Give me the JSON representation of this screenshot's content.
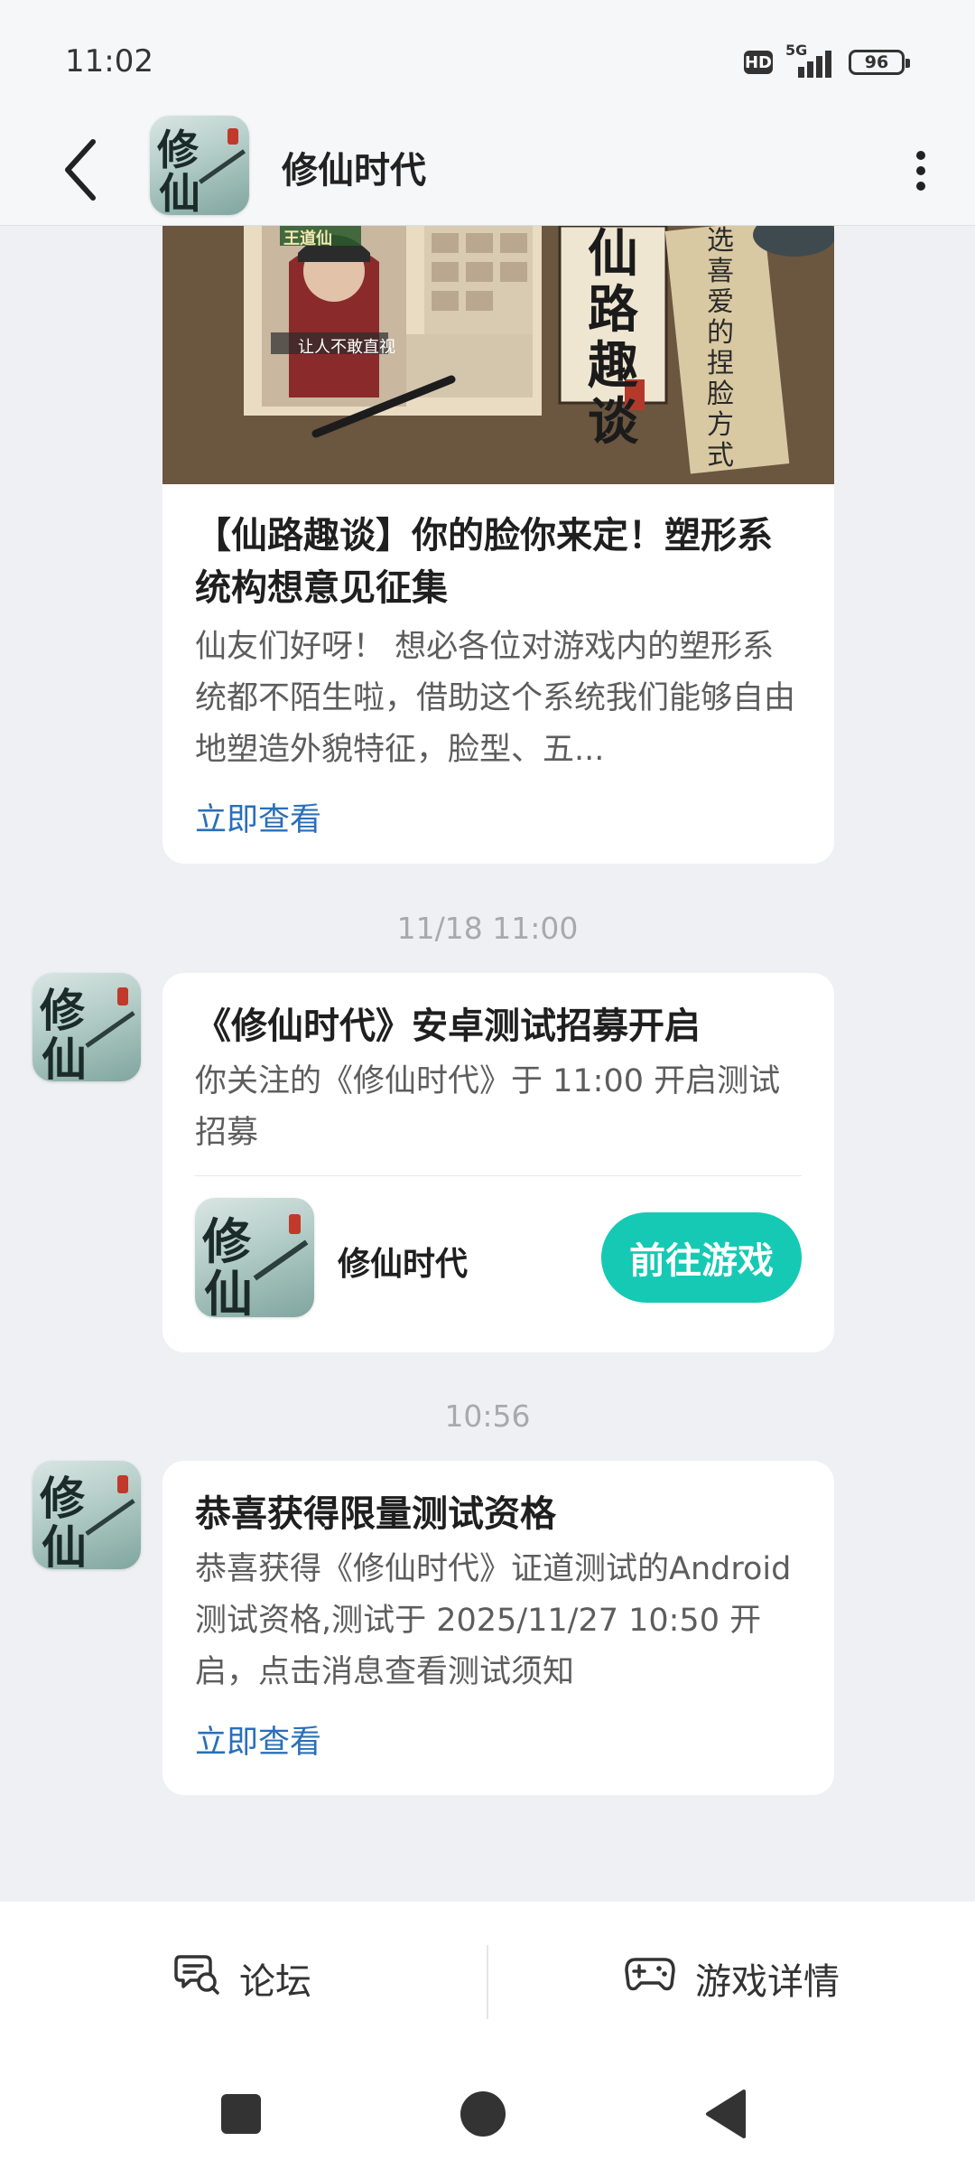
{
  "status_bar": {
    "time": "11:02",
    "hd": "HD",
    "network": "5G",
    "battery": "96"
  },
  "header": {
    "title": "修仙时代"
  },
  "app_icon": {
    "glyph_1": "修",
    "glyph_2": "仙"
  },
  "cards": [
    {
      "title": "【仙路趣谈】你的脸你来定！塑形系统构想意见征集",
      "body": "仙友们好呀！ 想必各位对游戏内的塑形系统都不陌生啦，借助这个系统我们能够自由地塑造外貌特征，脸型、五...",
      "link": "立即查看",
      "banner": {
        "col_1": "仙路趣谈",
        "col_2": "选喜爱的捏脸方式",
        "tag": "王道仙",
        "caption": "让人不敢直视"
      }
    },
    {
      "timestamp": "11/18  11:00",
      "title": "《修仙时代》安卓测试招募开启",
      "body": "你关注的《修仙时代》于 11:00 开启测试招募",
      "game_name": "修仙时代",
      "button": "前往游戏"
    },
    {
      "timestamp": "10:56",
      "title": "恭喜获得限量测试资格",
      "body": "恭喜获得《修仙时代》证道测试的Android测试资格,测试于 2025/11/27 10:50 开启，点击消息查看测试须知",
      "link": "立即查看"
    }
  ],
  "bottom_tabs": [
    {
      "label": "论坛",
      "icon": "forum-icon"
    },
    {
      "label": "游戏详情",
      "icon": "gamepad-icon"
    }
  ],
  "colors": {
    "accent": "#16c9b4",
    "link": "#2a6fb8",
    "background": "#eef0f3"
  }
}
